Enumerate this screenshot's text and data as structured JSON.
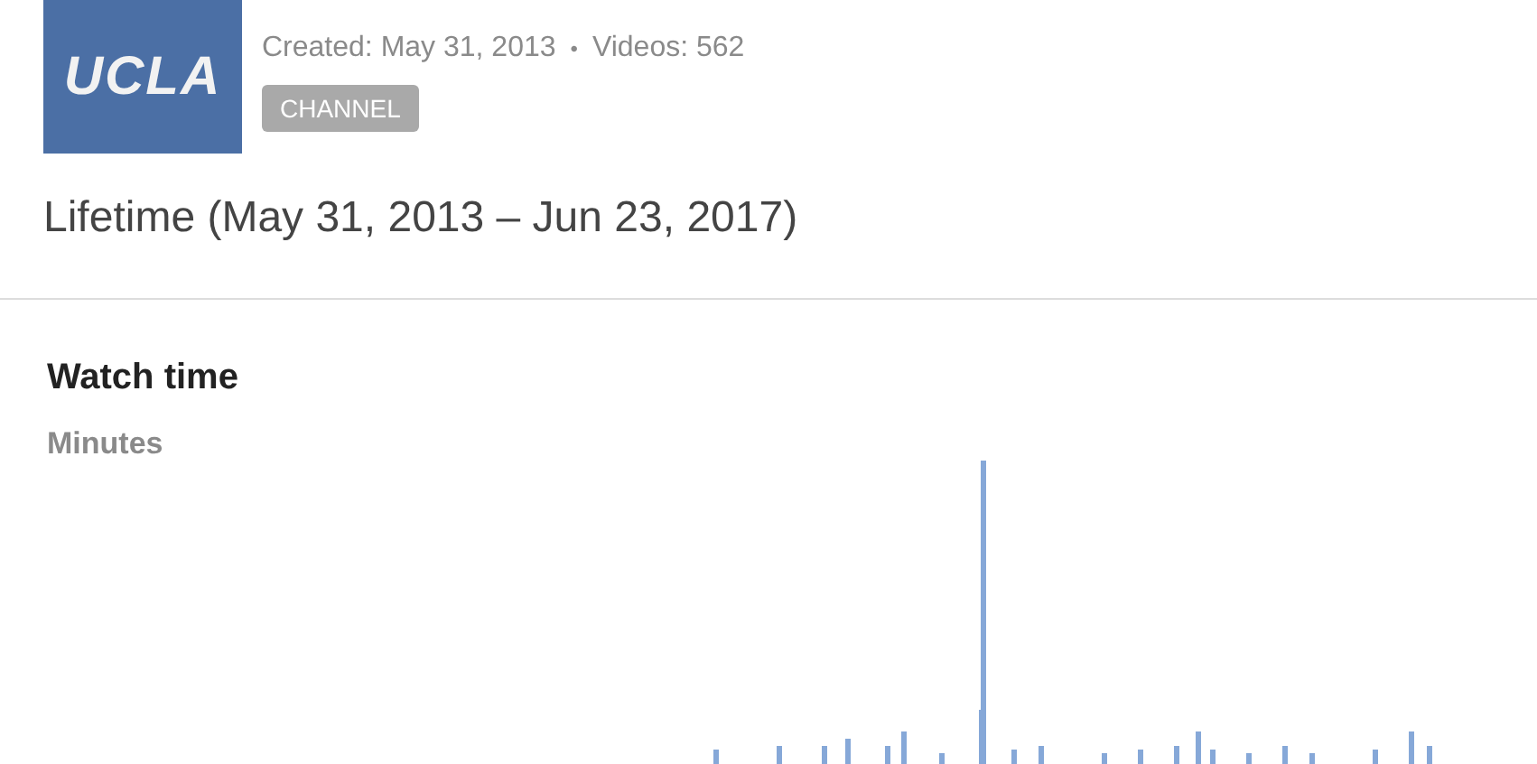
{
  "channel": {
    "logo_text": "UCLA",
    "created": "Created: May 31, 2013",
    "separator": "•",
    "videos": "Videos: 562",
    "badge": "CHANNEL"
  },
  "period": "Lifetime (May 31, 2013 – Jun 23, 2017)",
  "metric": {
    "title": "Watch time",
    "unit": "Minutes"
  }
}
